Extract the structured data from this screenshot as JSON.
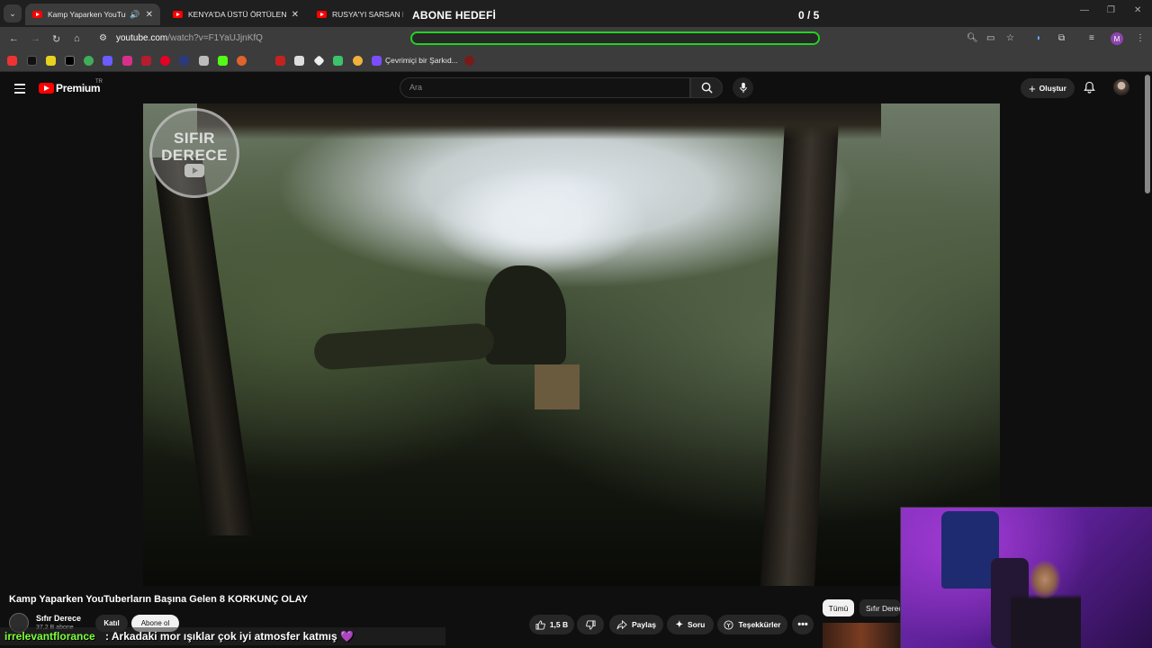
{
  "browser": {
    "tabs": [
      {
        "label": "Kamp Yaparken YouTuberla",
        "active": true
      },
      {
        "label": "KENYA'DA ÜSTÜ ÖRTÜLEN KOR",
        "active": false
      },
      {
        "label": "RUSYA'YI SARSAN KARANLIK",
        "active": false
      }
    ],
    "tab_close": "✕",
    "address": {
      "host": "youtube.com",
      "path": "/watch?v=F1YaUJjnKfQ"
    },
    "profile_initial": "M",
    "bookmark_label": "Çevrimiçi bir Şarkıd..."
  },
  "overlay": {
    "goal_title": "ABONE HEDEFİ",
    "goal_count": "0 / 5",
    "goal_progress": 0.0,
    "goal_color": "#22d322"
  },
  "youtube": {
    "logo_text": "Premium",
    "logo_region": "TR",
    "search_placeholder": "Ara",
    "create_label": "Oluştur"
  },
  "video": {
    "watermark_line1": "SIFIR",
    "watermark_line2": "DERECE",
    "title": "Kamp Yaparken YouTuberların Başına Gelen 8 KORKUNÇ OLAY",
    "channel_name": "Sıfır Derece",
    "subscribers": "37,2 B abone",
    "join_label": "Katıl",
    "subscribe_label": "Abone ol",
    "likes": "1,5 B",
    "share_label": "Paylaş",
    "ask_label": "Soru",
    "thanks_label": "Teşekkürler"
  },
  "chips": {
    "all": "Tümü",
    "channel": "Sıfır Derece"
  },
  "chat": {
    "username": "irrelevantflorance",
    "message": ": Arkadaki mor ışıklar çok iyi atmosfer katmış 💜"
  }
}
